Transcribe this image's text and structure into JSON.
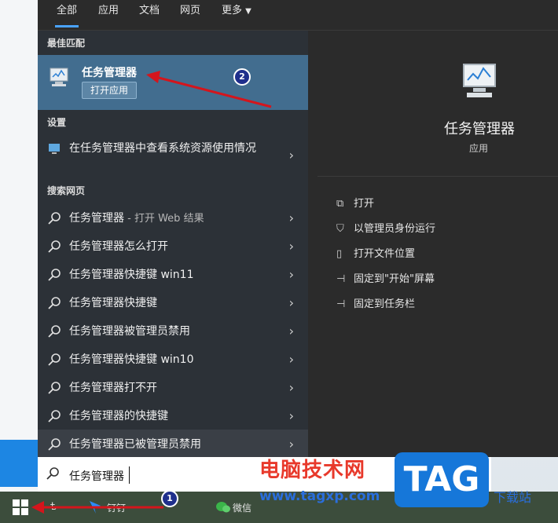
{
  "tabs": [
    "全部",
    "应用",
    "文档",
    "网页",
    "更多"
  ],
  "sections": {
    "best_match": "最佳匹配",
    "settings": "设置",
    "web_search": "搜索网页"
  },
  "best_match": {
    "title": "任务管理器",
    "open_label": "打开应用"
  },
  "settings_item": "在任务管理器中查看系统资源使用情况",
  "web_results": [
    {
      "text": "任务管理器",
      "sub": " - 打开 Web 结果"
    },
    {
      "text": "任务管理器怎么打开",
      "sub": ""
    },
    {
      "text": "任务管理器快捷键 win11",
      "sub": ""
    },
    {
      "text": "任务管理器快捷键",
      "sub": ""
    },
    {
      "text": "任务管理器被管理员禁用",
      "sub": ""
    },
    {
      "text": "任务管理器快捷键 win10",
      "sub": ""
    },
    {
      "text": "任务管理器打不开",
      "sub": ""
    },
    {
      "text": "任务管理器的快捷键",
      "sub": ""
    },
    {
      "text": "任务管理器已被管理员禁用",
      "sub": ""
    }
  ],
  "detail": {
    "app_name": "任务管理器",
    "app_type": "应用",
    "actions": [
      "打开",
      "以管理员身份运行",
      "打开文件位置",
      "固定到\"开始\"屏幕",
      "固定到任务栏"
    ]
  },
  "search": {
    "value": "任务管理器"
  },
  "taskbar": {
    "item1": "ѣ",
    "item2": "钉钉",
    "item3": "微信"
  },
  "annotations": {
    "badge1": "1",
    "badge2": "2"
  },
  "watermark": {
    "cn": "电脑技术网",
    "url": "www.tagxp.com",
    "tag": "TAG",
    "side": "下载站"
  },
  "colors": {
    "accent": "#4aa3ff",
    "selected_bg": "#426d8f",
    "arrow": "#d4151c"
  }
}
